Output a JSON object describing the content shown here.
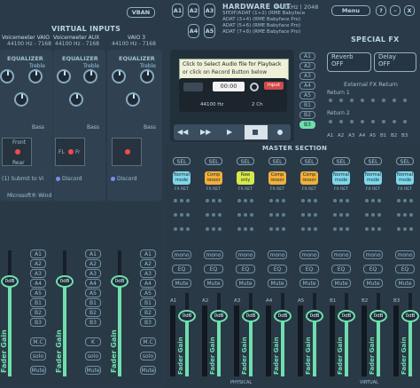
{
  "virtual_inputs": {
    "title": "VIRTUAL INPUTS",
    "vban": "VBAN",
    "strips": [
      {
        "name": "Voicemeeter VAIO",
        "freq": "44100 Hz - 7168"
      },
      {
        "name": "Voicemeeter AUX",
        "freq": "44100 Hz - 7168"
      },
      {
        "name": "VAIO 3",
        "freq": "44100 Hz - 7168"
      }
    ],
    "eq_label": "EQUALIZER",
    "treble": "Treble",
    "bass": "Bass",
    "front": "Front",
    "rear": "Rear",
    "fl": "FL",
    "fr": "Fr",
    "submit": "(1) Submit to Vi",
    "discord": "Discord",
    "microsoft": "Microsoft® Wind",
    "bus_buttons": [
      "A1",
      "A2",
      "A3",
      "A4",
      "A5",
      "B1",
      "B2",
      "B3"
    ],
    "mc": "M.C",
    "k": "K",
    "solo": "solo",
    "mute": "Mute",
    "fader_db": "0dB",
    "fader_label": "Fader Gain"
  },
  "hardware_out": {
    "a_buttons": [
      "A1",
      "A2",
      "A3",
      "A4",
      "A5"
    ],
    "title": "HARDWARE OUT",
    "rate": "44.1kHz | 2048",
    "devices": [
      "SPDIF/ADAT (1+2) (RME Babyface",
      "ADAT (3+4) (RME Babyface Pro)",
      "ADAT (5+6) (RME Babyface Pro)",
      "ADAT (7+8) (RME Babyface Pro)"
    ],
    "menu": "Menu",
    "help": "?",
    "minimize": "–",
    "close": "X"
  },
  "player": {
    "prompt1": "Click to Select Audio file for Playback",
    "prompt2": "or click on Record Button below",
    "time": "00:00",
    "input": "input",
    "rate": "44100 Hz",
    "ch": "2 Ch",
    "bus_tags": [
      "A1",
      "A2",
      "A3",
      "A4",
      "A5",
      "B1",
      "B2",
      "B3"
    ]
  },
  "special_fx": {
    "title": "SPECIAL FX",
    "reverb": "Reverb",
    "reverb_state": "OFF",
    "delay": "Delay",
    "delay_state": "OFF",
    "ext_title": "External FX Return",
    "return1": "Return 1",
    "return2": "Return 2",
    "buses": [
      "A1",
      "A2",
      "A3",
      "A4",
      "A5",
      "B1",
      "B2",
      "B3"
    ]
  },
  "master": {
    "title": "MASTER SECTION",
    "sel": "SEL",
    "fx": [
      {
        "l1": "Normal",
        "l2": "mode",
        "color": "#7fd7e9"
      },
      {
        "l1": "Comp",
        "l2": "ressor",
        "color": "#f0b03a"
      },
      {
        "l1": "Raw",
        "l2": "only",
        "color": "#d8e84a"
      },
      {
        "l1": "Comp",
        "l2": "ressor",
        "color": "#f0b03a"
      },
      {
        "l1": "Comp",
        "l2": "ressor",
        "color": "#f0b03a"
      },
      {
        "l1": "Normal",
        "l2": "mode",
        "color": "#7fd7e9"
      },
      {
        "l1": "Normal",
        "l2": "mode",
        "color": "#7fd7e9"
      },
      {
        "l1": "Normal",
        "l2": "mode",
        "color": "#7fd7e9"
      }
    ],
    "fxret": "FX RET",
    "mono": "mono",
    "eq": "EQ",
    "mute": "Mute",
    "fader_db": "0dB",
    "fader_label": "Fader Gain",
    "bus_names": [
      "A1",
      "A2",
      "A3",
      "A4",
      "A5",
      "B1",
      "B2",
      "B3"
    ],
    "physical": "PHYSICAL",
    "virtual": "VIRTUAL"
  },
  "colors": {
    "accent_green": "#6fdfae",
    "background": "#2b3a49"
  }
}
